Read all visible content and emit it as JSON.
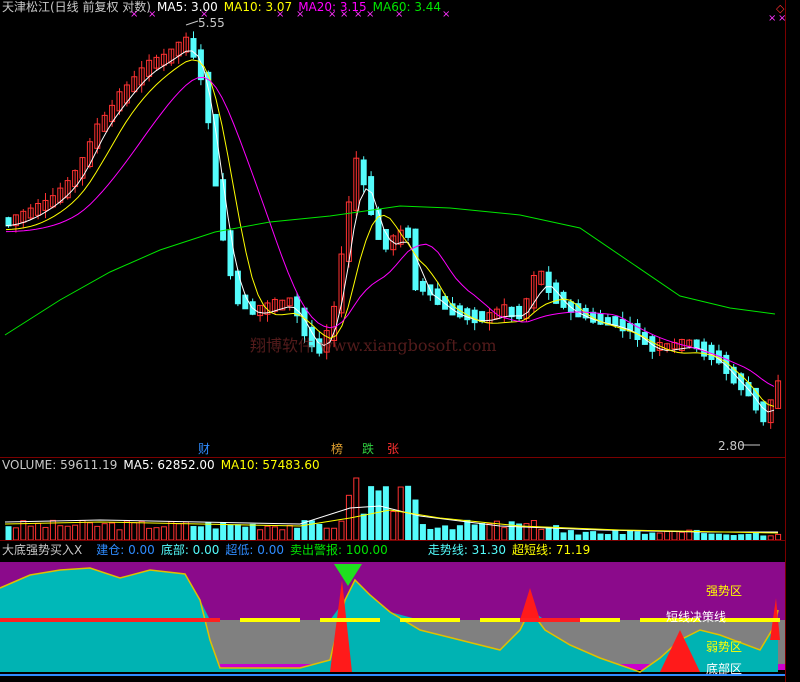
{
  "price_header": {
    "title": "天津松江(日线 前复权 对数)",
    "ma5": "MA5: 3.00",
    "ma10": "MA10: 3.07",
    "ma20": "MA20: 3.15",
    "ma60": "MA60: 3.44"
  },
  "price_pane": {
    "high_label": "5.55",
    "low_label": "2.80",
    "watermark": "翔博软件 www.xiangbosoft.com",
    "event_tags": [
      "财",
      "榜",
      "跌",
      "张"
    ],
    "top_markers": [
      "×",
      "×",
      "×",
      "×",
      "×"
    ],
    "corner_markers": [
      "◇",
      "◇"
    ]
  },
  "volume_header": {
    "volume": "VOLUME: 59611.19",
    "ma5": "MA5: 62852.00",
    "ma10": "MA10: 57483.60"
  },
  "indicator_header": {
    "name": "大底强势买入X",
    "jiancang": "建仓: 0.00",
    "dibu": "底部: 0.00",
    "chaodi": "超低: 0.00",
    "maichu": "卖出警报: 100.00",
    "zoushi": "走势线: 31.30",
    "chaoduan": "超短线: 71.19"
  },
  "indicator_pane": {
    "zones": [
      "强势区",
      "短线决策线",
      "弱势区",
      "底部区"
    ]
  },
  "colors": {
    "up": "#ff3232",
    "down": "#54fcfc",
    "ma5": "#ffffff",
    "ma10": "#ffff00",
    "ma20": "#ff00ff",
    "ma60": "#00e600",
    "strong_zone": "#8b0a8b",
    "weak_zone": "#808080",
    "decision_line": "#ffff00"
  },
  "chart_data": {
    "type": "candlestick",
    "title": "天津松江(日线 前复权 对数)",
    "ylim": [
      2.8,
      5.55
    ],
    "high": 5.55,
    "low": 2.8,
    "moving_averages": {
      "MA5": 3.0,
      "MA10": 3.07,
      "MA20": 3.15,
      "MA60": 3.44
    },
    "volume": {
      "VOLUME": 59611.19,
      "MA5": 62852.0,
      "MA10": 57483.6
    },
    "indicator": {
      "建仓": 0.0,
      "底部": 0.0,
      "超低": 0.0,
      "卖出警报": 100.0,
      "走势线": 31.3,
      "超短线": 71.19
    }
  }
}
